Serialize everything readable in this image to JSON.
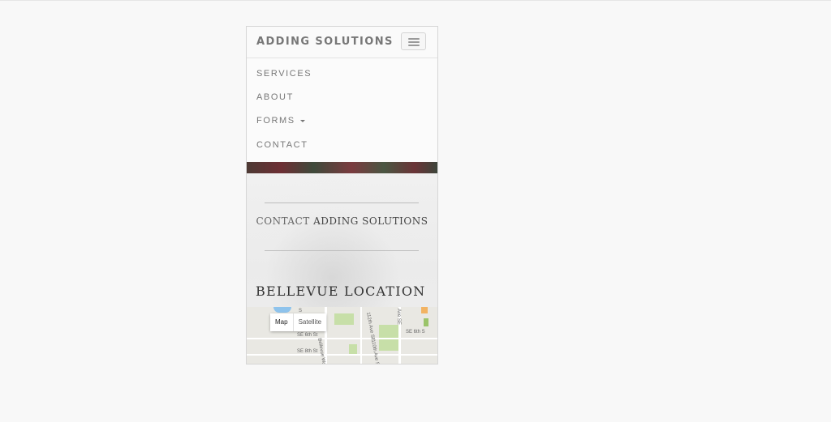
{
  "navbar": {
    "brand": "ADDING SOLUTIONS"
  },
  "menu": {
    "items": [
      {
        "label": "SERVICES"
      },
      {
        "label": "ABOUT"
      },
      {
        "label": "FORMS"
      },
      {
        "label": "CONTACT"
      }
    ]
  },
  "hero": {
    "contact_prefix": "CONTACT",
    "contact_strong": "ADDING SOLUTIONS"
  },
  "location": {
    "title": "BELLEVUE LOCATION"
  },
  "map": {
    "controls": {
      "map_label": "Map",
      "satellite_label": "Satellite"
    },
    "street_labels": [
      "SE 6th St",
      "SE 8th St",
      "SE 6th S",
      "Bellevue Wa",
      "112th Ave SE",
      "110th Ave SE",
      "Ave SE",
      "S"
    ],
    "colors": {
      "land": "#e9e8e3",
      "park": "#c7dfa8",
      "water": "#8ec3ec",
      "road": "#ffffff"
    }
  },
  "colors": {
    "page_background": "#f8f8f8",
    "navbar_text": "#777777",
    "heading_text": "#333333"
  }
}
